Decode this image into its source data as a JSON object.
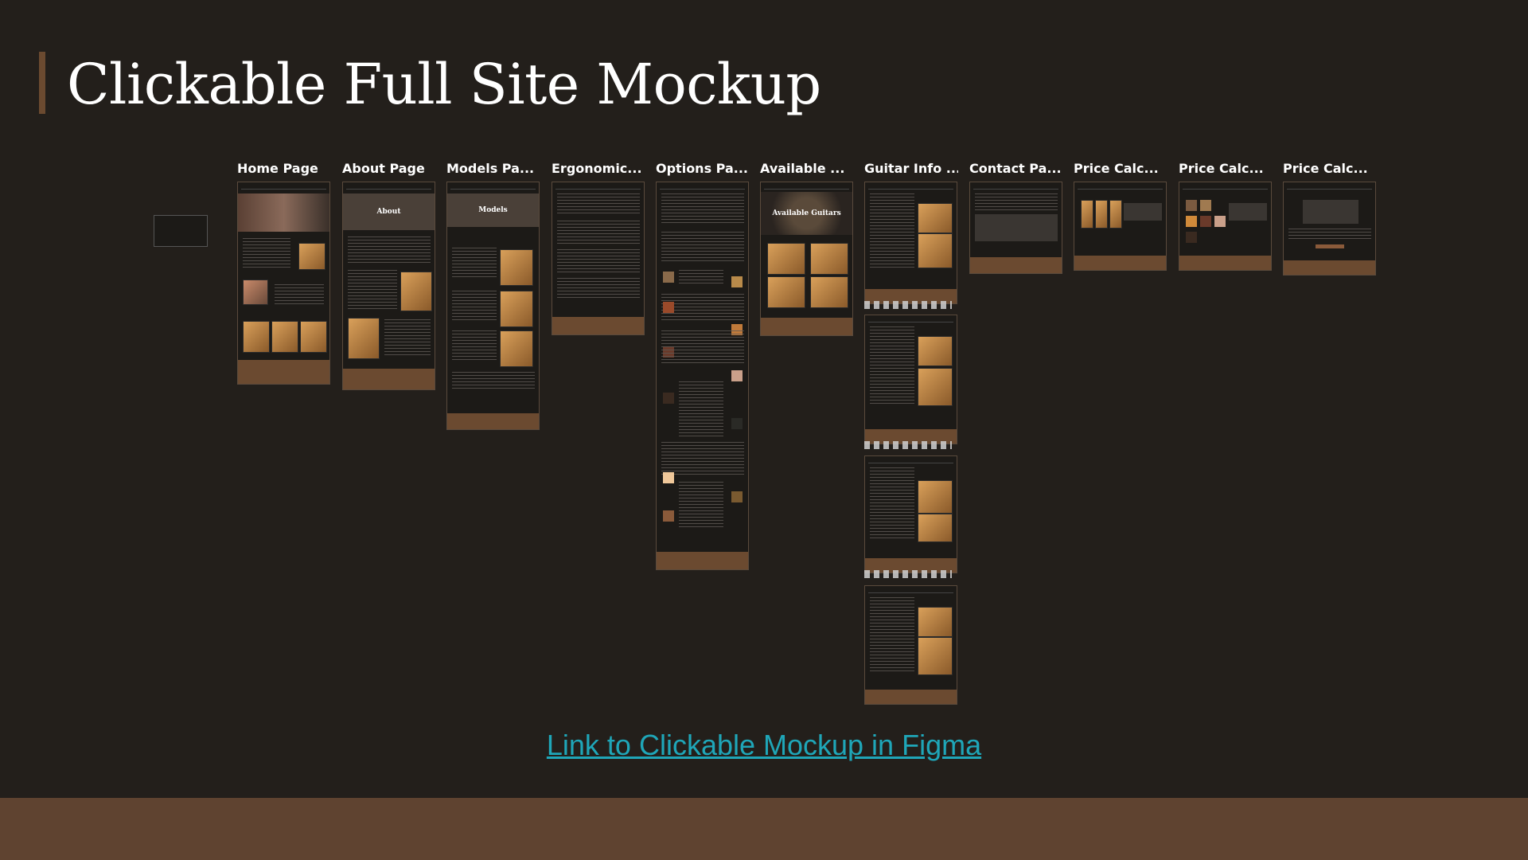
{
  "slide": {
    "title": "Clickable Full Site Mockup",
    "link_text": "Link to Clickable Mockup in Figma"
  },
  "frames": {
    "home": {
      "label": "Home Page"
    },
    "about": {
      "label": "About Page",
      "hero_text": "About"
    },
    "models": {
      "label": "Models Pa...",
      "hero_text": "Models"
    },
    "ergonomics": {
      "label": "Ergonomic..."
    },
    "options": {
      "label": "Options Pa..."
    },
    "available": {
      "label": "Available ...",
      "hero_text": "Available Guitars"
    },
    "guitar_info": {
      "label": "Guitar Info ..."
    },
    "contact": {
      "label": "Contact Pa..."
    },
    "price1": {
      "label": "Price Calc..."
    },
    "price2": {
      "label": "Price Calc..."
    },
    "price3": {
      "label": "Price Calc..."
    }
  },
  "colors": {
    "background": "#231f1b",
    "accent": "#6b4a30",
    "footer_band": "#5f4330",
    "link": "#1fa6b8"
  }
}
